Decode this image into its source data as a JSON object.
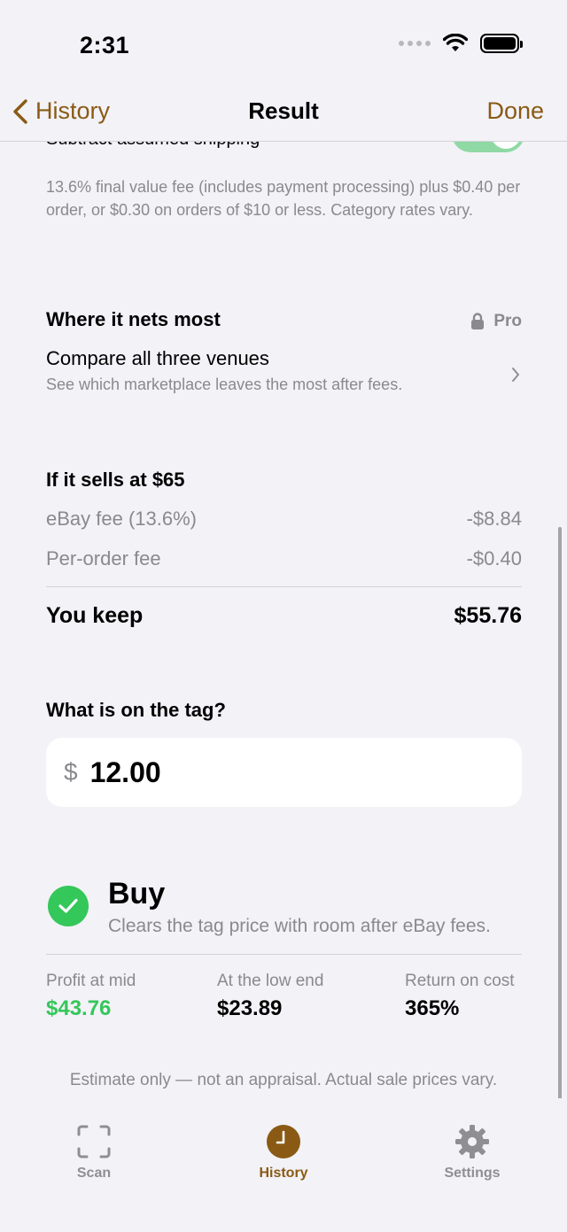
{
  "status": {
    "time": "2:31"
  },
  "nav": {
    "back_label": "History",
    "title": "Result",
    "done_label": "Done"
  },
  "shipping": {
    "toggle_label": "Subtract assumed shipping",
    "toggle_on": true,
    "fee_note": "13.6% final value fee (includes payment processing) plus $0.40 per order, or $0.30 on orders of $10 or less. Category rates vary."
  },
  "venues": {
    "heading": "Where it nets most",
    "badge": "Pro",
    "item_title": "Compare all three venues",
    "item_subtitle": "See which marketplace leaves the most after fees."
  },
  "breakdown": {
    "heading": "If it sells at $65",
    "rows": [
      {
        "label": "eBay fee (13.6%)",
        "value": "-$8.84"
      },
      {
        "label": "Per-order fee",
        "value": "-$0.40"
      }
    ],
    "total_label": "You keep",
    "total_value": "$55.76"
  },
  "tag": {
    "question": "What is on the tag?",
    "currency": "$",
    "value": "12.00"
  },
  "verdict": {
    "title": "Buy",
    "subtitle": "Clears the tag price with room after eBay fees.",
    "stats": [
      {
        "label": "Profit at mid",
        "value": "$43.76",
        "color": "#34c759"
      },
      {
        "label": "At the low end",
        "value": "$23.89",
        "color": "#000000"
      },
      {
        "label": "Return on cost",
        "value": "365%",
        "color": "#000000"
      }
    ]
  },
  "disclaimer": "Estimate only — not an appraisal. Actual sale prices vary.",
  "tabs": [
    {
      "label": "Scan",
      "icon": "scan-icon",
      "active": false
    },
    {
      "label": "History",
      "icon": "clock-icon",
      "active": true
    },
    {
      "label": "Settings",
      "icon": "gear-icon",
      "active": false
    }
  ],
  "colors": {
    "accent": "#8a5a14",
    "positive": "#34c759",
    "background": "#f2f2f7"
  }
}
